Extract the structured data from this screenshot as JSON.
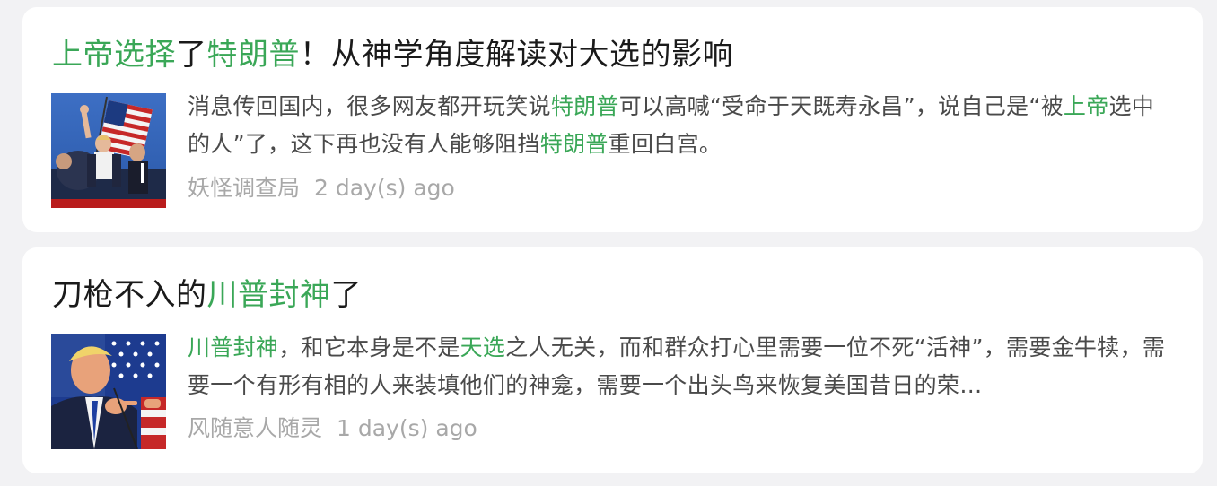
{
  "results": [
    {
      "title": {
        "parts": [
          {
            "text": "上帝选择",
            "highlight": true
          },
          {
            "text": "了",
            "highlight": false
          },
          {
            "text": "特朗普",
            "highlight": true
          },
          {
            "text": "！从神学角度解读对大选的影响",
            "highlight": false
          }
        ]
      },
      "snippet": {
        "parts": [
          {
            "text": "消息传回国内，很多网友都开玩笑说",
            "highlight": false
          },
          {
            "text": "特朗普",
            "highlight": true
          },
          {
            "text": "可以高喊“受命于天既寿永昌”，说自己是“被",
            "highlight": false
          },
          {
            "text": "上帝",
            "highlight": true
          },
          {
            "text": "选中的人”了，这下再也没有人能够阻挡",
            "highlight": false
          },
          {
            "text": "特朗普",
            "highlight": true
          },
          {
            "text": "重回白宫。",
            "highlight": false
          }
        ]
      },
      "source": "妖怪调查局",
      "time": "2 day(s) ago"
    },
    {
      "title": {
        "parts": [
          {
            "text": "刀枪不入的",
            "highlight": false
          },
          {
            "text": "川普封神",
            "highlight": true
          },
          {
            "text": "了",
            "highlight": false
          }
        ]
      },
      "snippet": {
        "parts": [
          {
            "text": "川普封神",
            "highlight": true
          },
          {
            "text": "，和它本身是不是",
            "highlight": false
          },
          {
            "text": "天选",
            "highlight": true
          },
          {
            "text": "之人无关，而和群众打心里需要一位不死“活神”，需要金牛犊，需要一个有形有相的人来装填他们的神龛，需要一个出头鸟来恢复美国昔日的荣…",
            "highlight": false
          }
        ]
      },
      "source": "风随意人随灵",
      "time": "1 day(s) ago"
    }
  ],
  "colors": {
    "highlight": "#3aa757",
    "title_text": "#1a1a1a",
    "snippet_text": "#4a4a4a",
    "meta_text": "#a8a8a8",
    "card_bg": "#ffffff",
    "page_bg": "#f2f2f4"
  }
}
